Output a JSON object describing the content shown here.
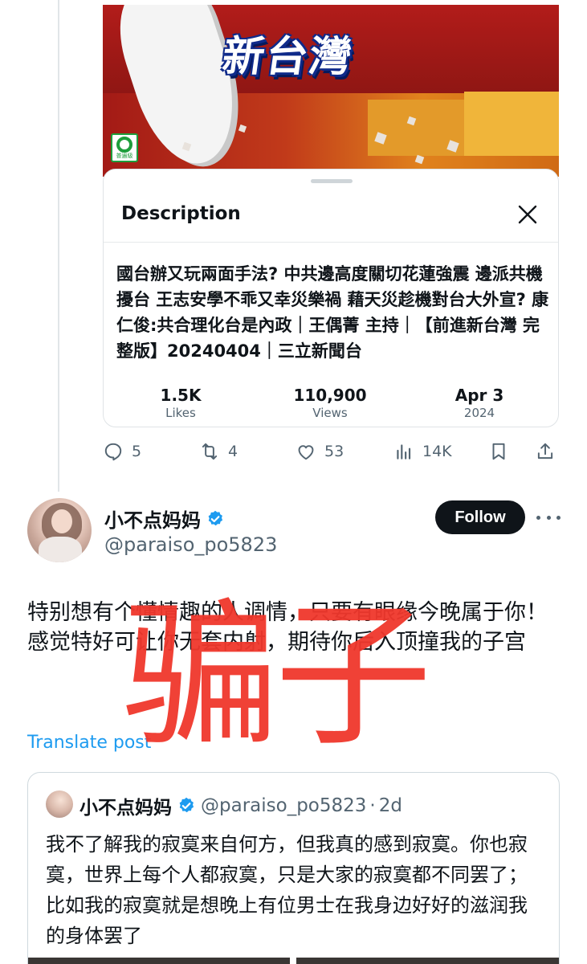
{
  "video": {
    "title_overlay": "新台灣",
    "rating_label": "普遍級"
  },
  "description_sheet": {
    "heading": "Description",
    "text": "國台辦又玩兩面手法? 中共邊高度關切花蓮強震 邊派共機擾台 王志安學不乖又幸災樂禍 藉天災趁機對台大外宣? 康仁俊:共合理化台是內政｜王偶菁 主持｜【前進新台灣 完整版】20240404｜三立新聞台",
    "stats": [
      {
        "value": "1.5K",
        "label": "Likes"
      },
      {
        "value": "110,900",
        "label": "Views"
      },
      {
        "value": "Apr 3",
        "label": "2024"
      }
    ]
  },
  "actions": {
    "replies": "5",
    "reposts": "4",
    "likes": "53",
    "views": "14K"
  },
  "tweet": {
    "display_name": "小不点妈妈",
    "handle": "@paraiso_po5823",
    "follow_label": "Follow",
    "text": "特别想有个懂情趣的人调情，只要有眼缘今晚属于你！感觉特好可让你无套内射，期待你后入顶撞我的子宫",
    "translate_label": "Translate post",
    "overlay_text": "骗子"
  },
  "quoted_tweet": {
    "display_name": "小不点妈妈",
    "handle": "@paraiso_po5823",
    "separator": "·",
    "time": "2d",
    "text": "我不了解我的寂寞来自何方，但我真的感到寂寞。你也寂寞，世界上每个人都寂寞，只是大家的寂寞都不同罢了；比如我的寂寞就是想晚上有位男士在我身边好好的滋润我的身体罢了"
  },
  "colors": {
    "accent_blue": "#1d9bf0",
    "overlay_red": "#f0372c",
    "secondary_text": "#536471",
    "primary_text": "#0f1419"
  },
  "icons": [
    "close-icon",
    "reply-icon",
    "repost-icon",
    "like-icon",
    "views-icon",
    "bookmark-icon",
    "share-icon",
    "verified-badge-icon",
    "more-icon"
  ]
}
